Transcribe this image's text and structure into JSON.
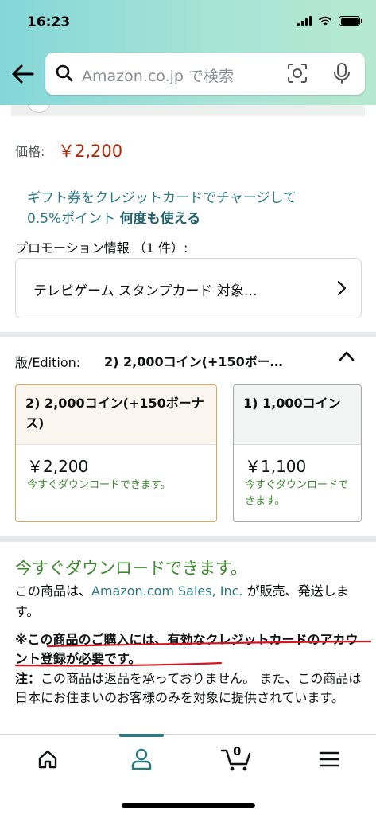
{
  "status_bar": {
    "time": "16:23"
  },
  "search": {
    "placeholder": "Amazon.co.jp で検索"
  },
  "price": {
    "label": "価格:",
    "value": "￥2,200"
  },
  "gift": {
    "line1": "ギフト券をクレジットカードでチャージして",
    "line2_prefix": "0.5%ポイント ",
    "line2_bold": "何度も使える"
  },
  "promotion": {
    "heading": "プロモーション情報 （1 件）:",
    "card_text": "テレビゲーム スタンプカード 対象…"
  },
  "edition": {
    "label": "版/Edition:",
    "selected": "2) 2,000コイン(+150ボー…",
    "options": [
      {
        "title": "2) 2,000コイン(+150ボーナス)",
        "price": "￥2,200",
        "availability": "今すぐダウンロードできます。"
      },
      {
        "title": "1) 1,000コイン",
        "price": "￥1,100",
        "availability": "今すぐダウンロードできます。"
      }
    ]
  },
  "availability": {
    "heading": "今すぐダウンロードできます。",
    "seller_prefix": "この商品は、",
    "seller_link": "Amazon.com Sales, Inc.",
    "seller_suffix": " が販売、発送します。"
  },
  "notice": {
    "text": "※この商品のご購入には、有効なクレジットカードのアカウント登録が必要です。"
  },
  "note": {
    "label": "注：",
    "text": "この商品は返品を承っておりません。 また、この商品は日本にお住まいのお客様のみを対象に提供されています。"
  },
  "tabbar": {
    "cart_count": "0",
    "active": "account"
  },
  "colors": {
    "price": "#b12704",
    "link": "#2b7a84",
    "success": "#3c8a2e",
    "selected_border": "#e3a35a",
    "annotation": "#d9141e"
  }
}
